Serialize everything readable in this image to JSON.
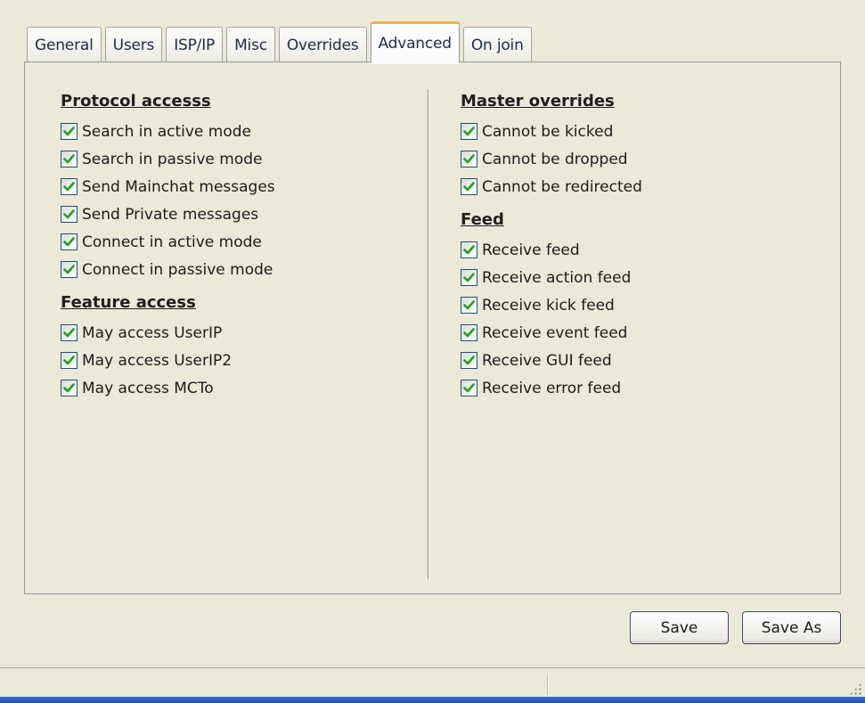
{
  "tabs": [
    {
      "label": "General",
      "active": false
    },
    {
      "label": "Users",
      "active": false
    },
    {
      "label": "ISP/IP",
      "active": false
    },
    {
      "label": "Misc",
      "active": false
    },
    {
      "label": "Overrides",
      "active": false
    },
    {
      "label": "Advanced",
      "active": true
    },
    {
      "label": "On join",
      "active": false
    }
  ],
  "left": {
    "protocol_heading": "Protocol accesss",
    "protocol_items": [
      {
        "label": "Search in active mode",
        "checked": true
      },
      {
        "label": "Search in passive mode",
        "checked": true
      },
      {
        "label": "Send Mainchat messages",
        "checked": true
      },
      {
        "label": "Send Private messages",
        "checked": true
      },
      {
        "label": "Connect in active mode",
        "checked": true
      },
      {
        "label": "Connect in passive mode",
        "checked": true
      }
    ],
    "feature_heading": "Feature access",
    "feature_items": [
      {
        "label": "May access UserIP",
        "checked": true
      },
      {
        "label": "May access UserIP2",
        "checked": true
      },
      {
        "label": "May access MCTo",
        "checked": true
      }
    ]
  },
  "right": {
    "master_heading": "Master overrides",
    "master_items": [
      {
        "label": "Cannot be kicked",
        "checked": true
      },
      {
        "label": "Cannot be dropped",
        "checked": true
      },
      {
        "label": "Cannot be redirected",
        "checked": true
      }
    ],
    "feed_heading": "Feed",
    "feed_items": [
      {
        "label": "Receive feed",
        "checked": true
      },
      {
        "label": "Receive action feed",
        "checked": true
      },
      {
        "label": "Receive kick feed",
        "checked": true
      },
      {
        "label": "Receive event feed",
        "checked": true
      },
      {
        "label": "Receive GUI feed",
        "checked": true
      },
      {
        "label": "Receive error feed",
        "checked": true
      }
    ]
  },
  "buttons": {
    "save_label": "Save",
    "save_as_label": "Save As"
  },
  "colors": {
    "window_bg": "#ece9d8",
    "active_tab_accent": "#f0b73c",
    "checkmark": "#21a121",
    "checkbox_border": "#1c5180"
  }
}
